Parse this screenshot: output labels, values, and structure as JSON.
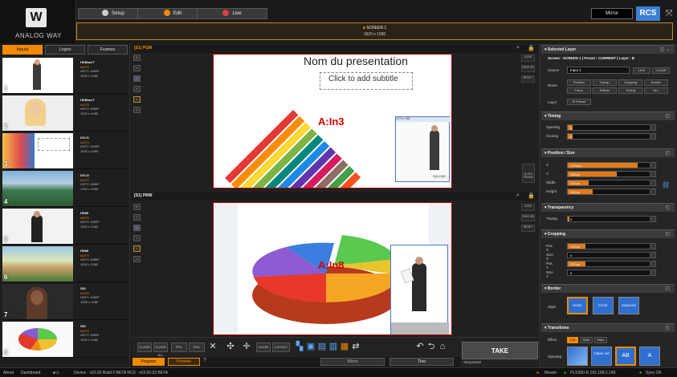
{
  "header": {
    "logo_text": "ANALOG WAY",
    "tabs": [
      {
        "label": "Setup",
        "icon": "gear-icon",
        "color": "#cccccc"
      },
      {
        "label": "Edit",
        "icon": "edit-icon",
        "color": "#f08a00"
      },
      {
        "label": "Live",
        "icon": "live-icon",
        "color": "#e04040"
      }
    ],
    "mini_label": "Mirror",
    "rcs_badge": "RCS",
    "screen_title": "SCREEN 1",
    "screen_res": "1920 x 1080"
  },
  "left": {
    "tabs": [
      "Inputs",
      "Logos",
      "Frames"
    ],
    "inputs": [
      {
        "num": "1",
        "name": "HDBaseT",
        "signal": "AUTO",
        "format": "HDTV 1080P",
        "res": "1920 x 1080"
      },
      {
        "num": "2",
        "name": "HDBaseT",
        "signal": "AUTO",
        "format": "HDTV 1080P",
        "res": "1920 x 1080"
      },
      {
        "num": "3",
        "name": "DVI-D",
        "signal": "AUTO",
        "format": "HDTV 1080P",
        "res": "1920 x 1080"
      },
      {
        "num": "4",
        "name": "DVI-D",
        "signal": "AUTO",
        "format": "HDTV 1080P",
        "res": "1920 x 1080"
      },
      {
        "num": "5",
        "name": "HDMI",
        "signal": "AUTO",
        "format": "HDTV 1080P",
        "res": "1920 x 1080"
      },
      {
        "num": "6",
        "name": "HDMI",
        "signal": "AUTO",
        "format": "HDTV 1080P",
        "res": "1920 x 1080"
      },
      {
        "num": "7",
        "name": "SDI",
        "signal": "AUTO",
        "format": "HDTV 1080P",
        "res": "1920 x 1080"
      },
      {
        "num": "8",
        "name": "SDI",
        "signal": "AUTO",
        "format": "HDTV 1080P",
        "res": "1920 x 1080"
      }
    ]
  },
  "center": {
    "pgm_label": "[S1] PGM",
    "prw_label": "[S1] PRW",
    "pgm_title": "Nom du presentation",
    "pgm_subtitle": "Click to add subtitle",
    "pgm_source": "A:In3",
    "prw_source": "A:In8",
    "layer_res_top": "1275 x 768",
    "layer_res_bottom": "315 x 456",
    "side_right_top": [
      "LOAD",
      "SAVE AS",
      "RESET"
    ],
    "side_right_bottom": [
      "LOAD",
      "SAVE AS",
      "RESET"
    ],
    "quick_frame": "QUICK FRAME",
    "toolbar_labels": [
      "CLEAR",
      "CLEAR ALL",
      "PGL",
      "ROL",
      "ALIGN",
      "LAYOUT"
    ],
    "take_label": "TAKE",
    "seq_label": "SEQUENCE",
    "program_label": "Program",
    "preview_label": "Preview",
    "help_label": "?",
    "mirror_label": "Mirror",
    "tbar_label": "Tbar"
  },
  "right": {
    "selected_layer": {
      "title": "Selected Layer",
      "info": "Screen : SCREEN 1 | Preset : CURRENT | Layer : B",
      "source_label": "Source",
      "source_value": "Input 1",
      "source_btns": [
        "LIVE",
        "CLEAR"
      ],
      "reset_label": "Reset",
      "reset_btns": [
        "Position",
        "Transp.",
        "Cropping",
        "Border",
        "Trans.",
        "Effects",
        "Timing",
        "ALL"
      ],
      "layer_label": "Layer",
      "freeze_label": "Freeze"
    },
    "timing": {
      "title": "Timing",
      "fields": [
        {
          "label": "Opening",
          "value": "0",
          "fill": 0.06
        },
        {
          "label": "Closing",
          "value": "0",
          "fill": 0.06
        }
      ]
    },
    "position": {
      "title": "Position / Size",
      "fields": [
        {
          "label": "X",
          "value": "1275 px",
          "fill": 0.85
        },
        {
          "label": "Y",
          "value": "768 px",
          "fill": 0.6
        },
        {
          "label": "Width",
          "value": "315 px",
          "fill": 0.25
        },
        {
          "label": "Height",
          "value": "456 px",
          "fill": 0.3
        }
      ]
    },
    "transparency": {
      "title": "Transparency",
      "fields": [
        {
          "label": "Transp.",
          "value": "0",
          "fill": 0.02
        }
      ]
    },
    "cropping": {
      "title": "Cropping",
      "fields": [
        {
          "label": "Pos X",
          "value": "270 px",
          "fill": 0.22
        },
        {
          "label": "Size X",
          "value": "0",
          "fill": 0.0
        },
        {
          "label": "Pos Y",
          "value": "270 px",
          "fill": 0.22
        },
        {
          "label": "Size Y",
          "value": "0",
          "fill": 0.0
        }
      ]
    },
    "border": {
      "title": "Border",
      "style_label": "Style",
      "styles": [
        "NONE",
        "EDGE",
        "SHADOW"
      ]
    },
    "transitions": {
      "title": "Transitions",
      "effect_label": "Effect",
      "effects": [
        "Cut",
        "Slide",
        "Wipe"
      ],
      "opening_label": "Opening",
      "thumbs": [
        "",
        "Clean cut",
        "AB",
        "A"
      ]
    }
  },
  "status": {
    "about": "About",
    "dashboard": "Dashboard",
    "device": "Device : v02.00 Build 0 BETA RCS : v02.00.02 BETA",
    "master": "Master",
    "ip": "PLS350-R 192.168.2.140",
    "sync": "Sync OK"
  }
}
